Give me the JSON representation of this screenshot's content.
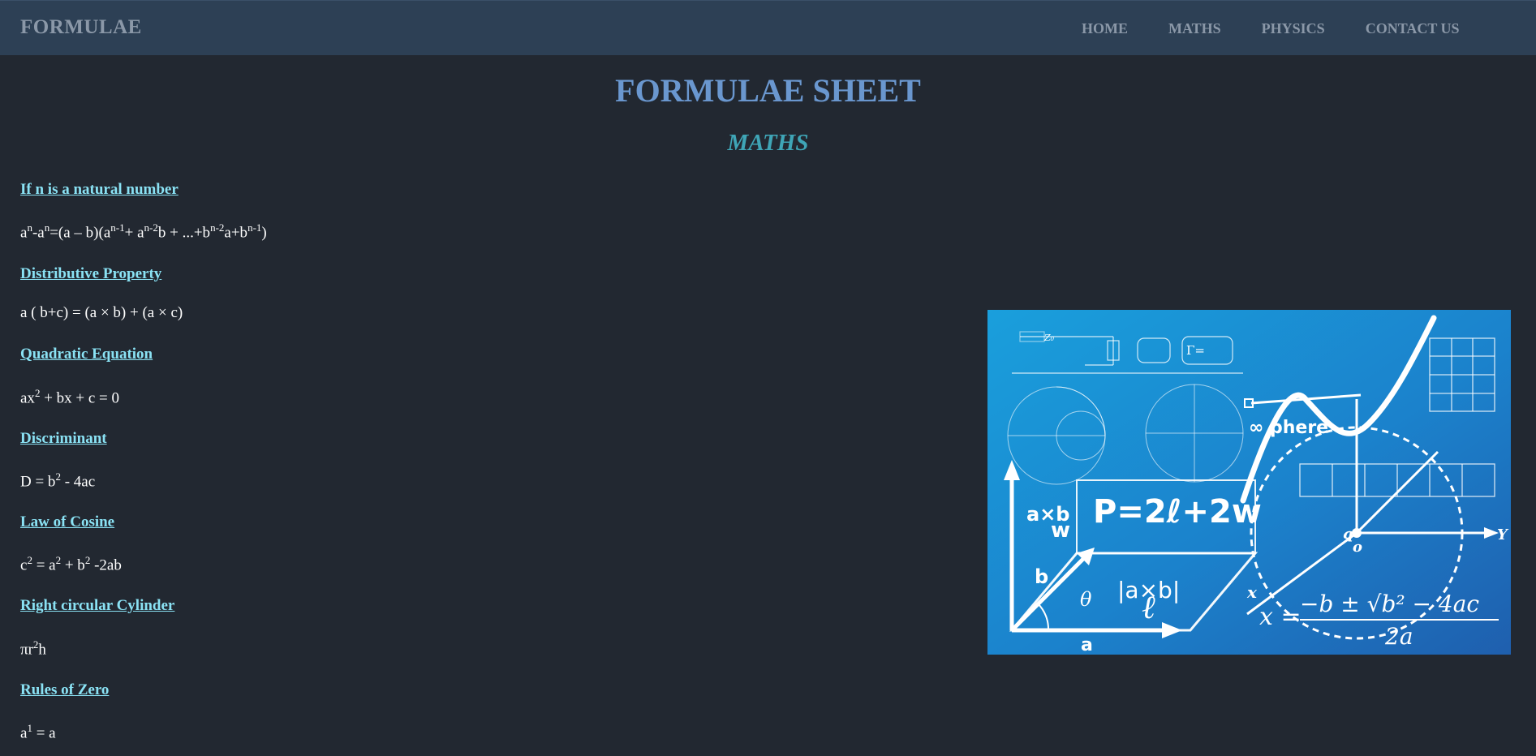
{
  "navbar": {
    "brand": "FORMULAE",
    "links": [
      {
        "label": "HOME"
      },
      {
        "label": "MATHS"
      },
      {
        "label": "PHYSICS"
      },
      {
        "label": "CONTACT US"
      }
    ]
  },
  "page": {
    "title": "FORMULAE SHEET",
    "section": "MATHS"
  },
  "topics": [
    {
      "heading": "If n is a natural number",
      "formula_parts": [
        "a",
        "n",
        "-a",
        "n",
        "=(a – b)(a",
        "n-1",
        "+ a",
        "n-2",
        "b + ...+b",
        "n-2",
        "a+b",
        "n-1",
        ")"
      ]
    },
    {
      "heading": "Distributive Property",
      "formula_parts": [
        "a ( b+c) = (a × b) + (a × c)"
      ]
    },
    {
      "heading": "Quadratic Equation",
      "formula_parts": [
        "ax",
        "2",
        " + bx + c = 0"
      ]
    },
    {
      "heading": "Discriminant",
      "formula_parts": [
        "D = b",
        "2",
        " - 4ac"
      ]
    },
    {
      "heading": "Law of Cosine",
      "formula_parts": [
        "c",
        "2",
        " = a",
        "2",
        " + b",
        "2",
        " -2ab"
      ]
    },
    {
      "heading": "Right circular Cylinder",
      "formula_parts": [
        "πr",
        "2",
        "h"
      ]
    },
    {
      "heading": "Rules of Zero",
      "formula_parts": [
        "a",
        "1",
        " = a"
      ]
    }
  ],
  "image": {
    "equations": {
      "perimeter": "P=2ℓ+2w",
      "cross": "|a×b|",
      "quadratic_lhs": "x =",
      "quadratic_num": "−b ± √b² − 4ac",
      "quadratic_den": "2a",
      "axb": "a×b",
      "w": "w",
      "a": "a",
      "b": "b",
      "theta": "θ",
      "ell": "ℓ",
      "sphere": "∞ phere",
      "y": "Y",
      "x": "x",
      "q": "q",
      "o": "o",
      "z0": "Z₀",
      "gamma": "Γ="
    },
    "colors": {
      "bg_top": "#1a9fdc",
      "bg_bottom": "#1f5fae",
      "line": "#ffffff"
    }
  }
}
